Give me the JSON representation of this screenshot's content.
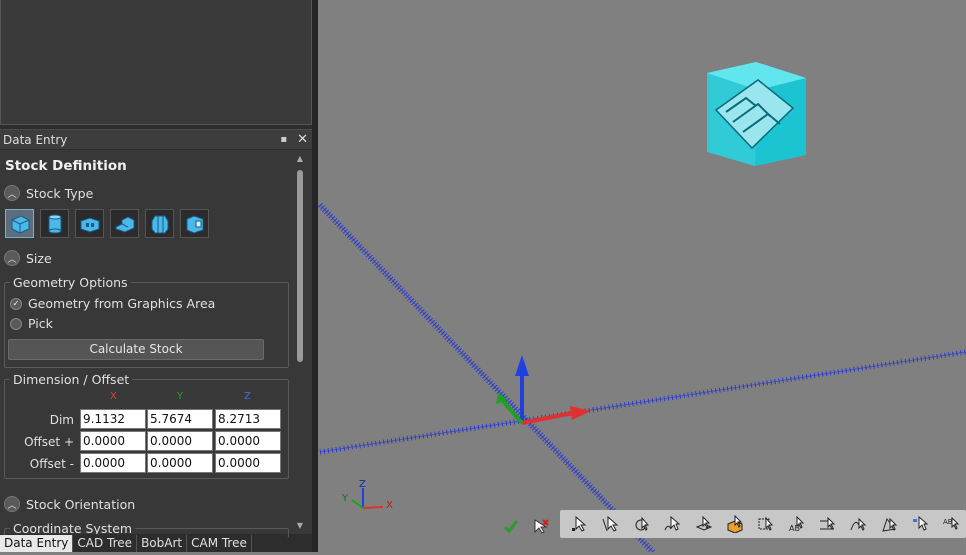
{
  "panel": {
    "header_title": "Data Entry",
    "title": "Stock Definition",
    "sections": {
      "stock_type": "Stock Type",
      "size": "Size",
      "stock_orientation": "Stock Orientation",
      "coordinate_system": "Coordinate System"
    },
    "geometry_options": {
      "legend": "Geometry Options",
      "option1": "Geometry from Graphics Area",
      "option2": "Pick",
      "selected": "Geometry from Graphics Area"
    },
    "calculate_button": "Calculate Stock",
    "dimension_offset": {
      "legend": "Dimension / Offset",
      "col_x": "X",
      "col_y": "Y",
      "col_z": "Z",
      "rows": [
        {
          "label": "Dim",
          "x": "9.1132",
          "y": "5.7674",
          "z": "8.2713"
        },
        {
          "label": "Offset +",
          "x": "0.0000",
          "y": "0.0000",
          "z": "0.0000"
        },
        {
          "label": "Offset -",
          "x": "0.0000",
          "y": "0.0000",
          "z": "0.0000"
        }
      ]
    }
  },
  "tabs": [
    "Data Entry",
    "CAD Tree",
    "BobArt",
    "CAM Tree"
  ],
  "active_tab": "Data Entry",
  "triad": {
    "x": "X",
    "y": "Y",
    "z": "Z"
  },
  "colors": {
    "stock_cube": "#27d3e0",
    "axis_x": "#e03030",
    "axis_y": "#20a020",
    "axis_z": "#2040e0",
    "grid_line": "#2a3ad0"
  }
}
